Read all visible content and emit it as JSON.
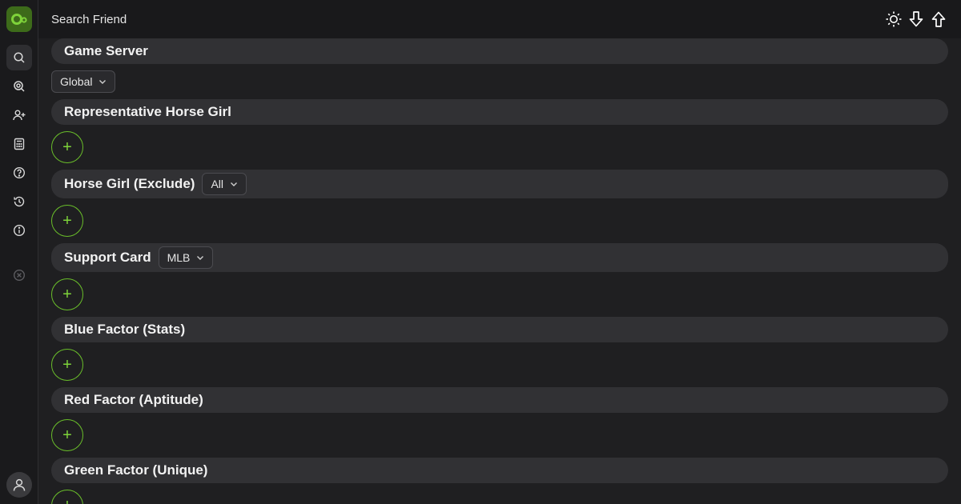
{
  "header": {
    "title": "Search Friend"
  },
  "sidebar": {
    "items": [
      {
        "icon": "search-icon"
      },
      {
        "icon": "search-detail-icon"
      },
      {
        "icon": "add-friend-icon"
      },
      {
        "icon": "calculator-icon"
      },
      {
        "icon": "help-icon"
      },
      {
        "icon": "history-icon"
      },
      {
        "icon": "info-icon"
      },
      {
        "icon": "close-circle-icon"
      }
    ]
  },
  "game_server": {
    "title": "Game Server",
    "dropdown_value": "Global"
  },
  "sections": {
    "representative": {
      "title": "Representative Horse Girl",
      "add_label": "+"
    },
    "exclude": {
      "title": "Horse Girl (Exclude)",
      "dropdown_value": "All",
      "add_label": "+"
    },
    "support": {
      "title": "Support Card",
      "dropdown_value": "MLB",
      "add_label": "+"
    },
    "blue": {
      "title": "Blue Factor (Stats)",
      "add_label": "+"
    },
    "red": {
      "title": "Red Factor (Aptitude)",
      "add_label": "+"
    },
    "green": {
      "title": "Green Factor (Unique)",
      "add_label": "+"
    }
  },
  "colors": {
    "accent": "#6abf2a",
    "background": "#1f1f21",
    "bar": "#313134"
  }
}
